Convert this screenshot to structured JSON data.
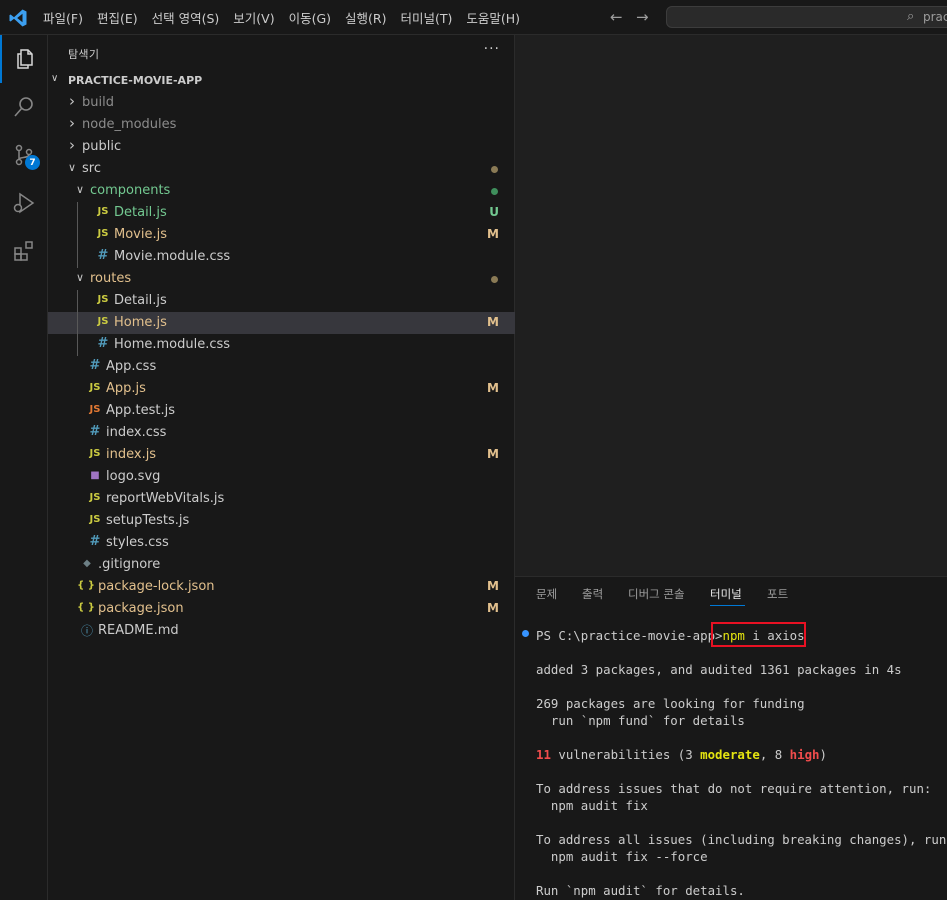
{
  "colors": {
    "accent": "#0078d4",
    "modified": "#e2c08d",
    "untracked": "#73c991",
    "js_icon": "#cbcb41",
    "css_icon": "#519aba",
    "svg_icon": "#a074c4",
    "json_icon": "#cbcb41",
    "highlight_box": "#e81123",
    "term_yellow": "#e5e510",
    "term_red": "#f14c4c"
  },
  "menu": [
    "파일(F)",
    "편집(E)",
    "선택 영역(S)",
    "보기(V)",
    "이동(G)",
    "실행(R)",
    "터미널(T)",
    "도움말(H)"
  ],
  "search": {
    "text": "prac"
  },
  "scm_badge": "7",
  "explorer": {
    "title": "탐색기",
    "more": "···",
    "root": "PRACTICE-MOVIE-APP",
    "items": [
      {
        "name": "build",
        "kind": "folder-closed",
        "depth": 0,
        "dim": true
      },
      {
        "name": "node_modules",
        "kind": "folder-closed",
        "depth": 0,
        "dim": true
      },
      {
        "name": "public",
        "kind": "folder-closed",
        "depth": 0
      },
      {
        "name": "src",
        "kind": "folder-open",
        "depth": 0,
        "dot": "mod"
      },
      {
        "name": "components",
        "kind": "folder-open",
        "depth": 1,
        "color": "untracked",
        "dot": "untracked"
      },
      {
        "name": "Detail.js",
        "kind": "js",
        "depth": 2,
        "color": "untracked",
        "status": "U"
      },
      {
        "name": "Movie.js",
        "kind": "js",
        "depth": 2,
        "color": "modified",
        "status": "M"
      },
      {
        "name": "Movie.module.css",
        "kind": "css",
        "depth": 2
      },
      {
        "name": "routes",
        "kind": "folder-open",
        "depth": 1,
        "color": "modified",
        "dot": "mod"
      },
      {
        "name": "Detail.js",
        "kind": "js",
        "depth": 2
      },
      {
        "name": "Home.js",
        "kind": "js",
        "depth": 2,
        "color": "modified",
        "status": "M",
        "selected": true
      },
      {
        "name": "Home.module.css",
        "kind": "css",
        "depth": 2
      },
      {
        "name": "App.css",
        "kind": "css",
        "depth": 1
      },
      {
        "name": "App.js",
        "kind": "js",
        "depth": 1,
        "color": "modified",
        "status": "M"
      },
      {
        "name": "App.test.js",
        "kind": "test",
        "depth": 1
      },
      {
        "name": "index.css",
        "kind": "css",
        "depth": 1
      },
      {
        "name": "index.js",
        "kind": "js",
        "depth": 1,
        "color": "modified",
        "status": "M"
      },
      {
        "name": "logo.svg",
        "kind": "svg",
        "depth": 1
      },
      {
        "name": "reportWebVitals.js",
        "kind": "js",
        "depth": 1
      },
      {
        "name": "setupTests.js",
        "kind": "js",
        "depth": 1
      },
      {
        "name": "styles.css",
        "kind": "css",
        "depth": 1
      },
      {
        "name": ".gitignore",
        "kind": "git",
        "depth": 0
      },
      {
        "name": "package-lock.json",
        "kind": "json",
        "depth": 0,
        "color": "modified",
        "status": "M"
      },
      {
        "name": "package.json",
        "kind": "json",
        "depth": 0,
        "color": "modified",
        "status": "M"
      },
      {
        "name": "README.md",
        "kind": "info",
        "depth": 0
      }
    ]
  },
  "panel": {
    "tabs": [
      "문제",
      "출력",
      "디버그 콘솔",
      "터미널",
      "포트"
    ],
    "active_tab": "터미널"
  },
  "terminal": {
    "prompt": "PS C:\\practice-movie-app>",
    "cmd_name": "npm",
    "cmd_args": " i axios",
    "lines": {
      "added": "added 3 packages, and audited 1361 packages in 4s",
      "funding1": "269 packages are looking for funding",
      "funding2": "  run `npm fund` for details",
      "vuln_count": "11",
      "vuln_pre": " vulnerabilities (3 ",
      "vuln_moderate": "moderate",
      "vuln_mid": ", 8 ",
      "vuln_high": "high",
      "vuln_post": ")",
      "fix1": "To address issues that do not require attention, run:",
      "fix1_cmd": "  npm audit fix",
      "fix2": "To address all issues (including breaking changes), run:",
      "fix2_cmd": "  npm audit fix --force",
      "audit": "Run `npm audit` for details."
    }
  }
}
